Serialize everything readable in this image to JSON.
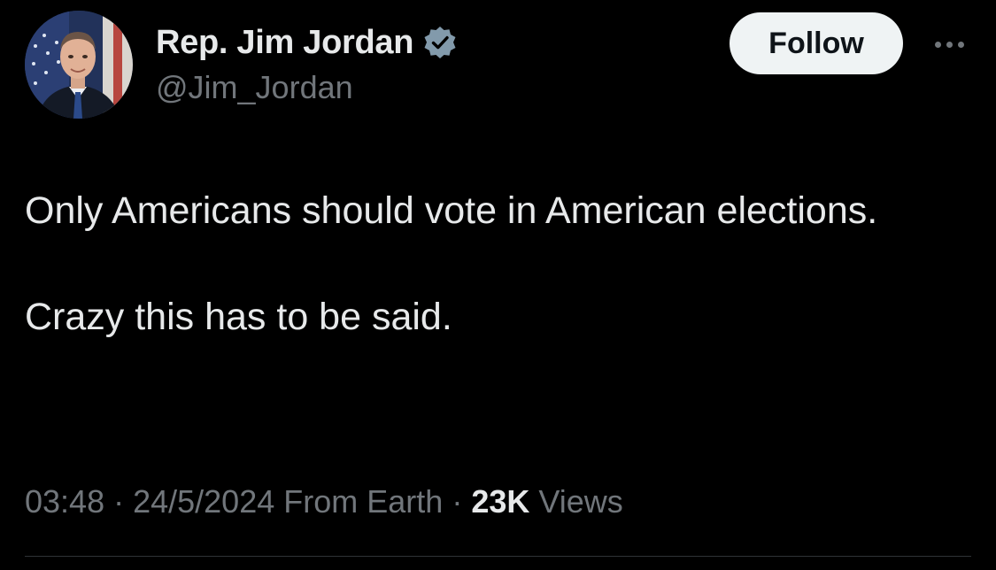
{
  "author": {
    "display_name": "Rep. Jim Jordan",
    "handle": "@Jim_Jordan",
    "verified": true,
    "verified_color": "#829aab",
    "avatar_icon": "profile-photo"
  },
  "actions": {
    "follow_label": "Follow",
    "more_icon": "ellipsis-icon"
  },
  "tweet": {
    "paragraphs": [
      "Only Americans should vote in American elections.",
      "Crazy this has to be said."
    ]
  },
  "meta": {
    "time": "03:48",
    "separator": " · ",
    "date": "24/5/2024",
    "source": "From Earth",
    "views_count": "23K",
    "views_label": "Views"
  },
  "colors": {
    "background": "#000000",
    "primary_text": "#e7e9ea",
    "secondary_text": "#71767b",
    "follow_bg": "#eff3f4",
    "follow_text": "#0f1419"
  }
}
